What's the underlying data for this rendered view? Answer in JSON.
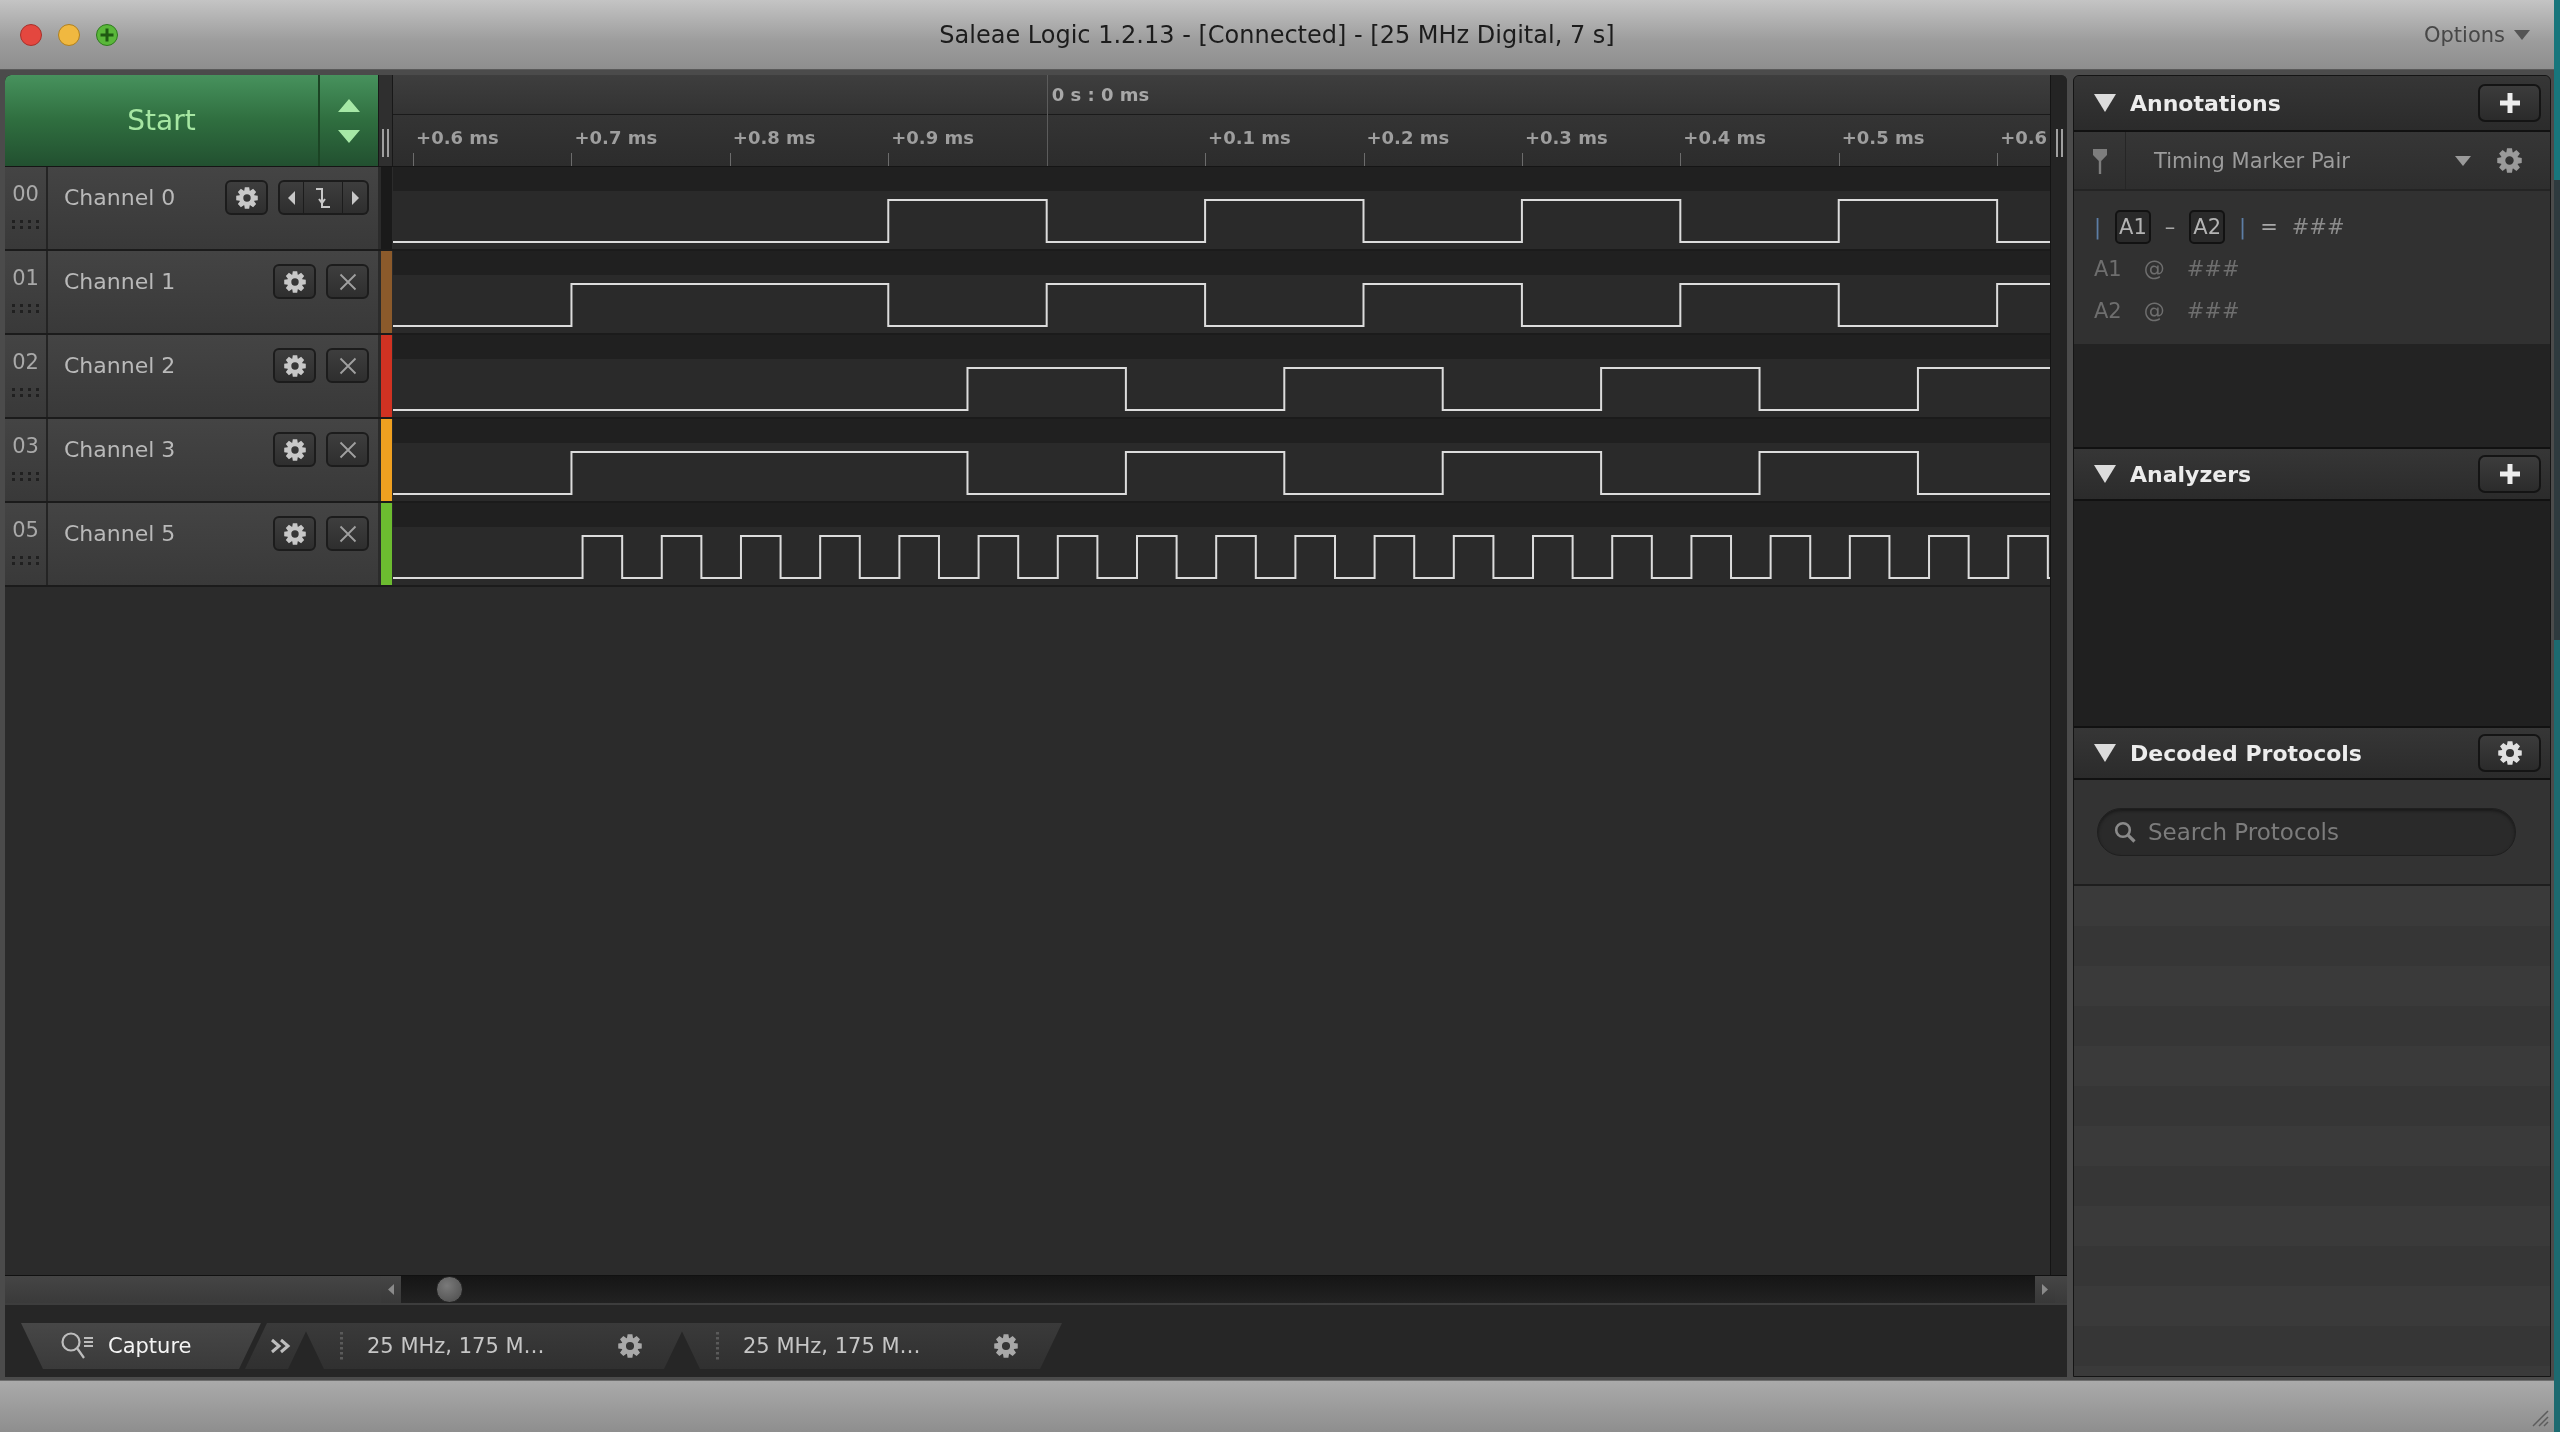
{
  "window": {
    "title": "Saleae Logic 1.2.13 - [Connected] - [25 MHz Digital, 7 s]",
    "options_menu": "Options"
  },
  "capture": {
    "start_button": "Start"
  },
  "ruler": {
    "origin": "0 s : 0 ms",
    "ticks_before": [
      "+0.6 ms",
      "+0.7 ms",
      "+0.8 ms",
      "+0.9 ms"
    ],
    "ticks_after": [
      "+0.1 ms",
      "+0.2 ms",
      "+0.3 ms",
      "+0.4 ms",
      "+0.5 ms",
      "+0.6"
    ]
  },
  "channels": [
    {
      "number": "00",
      "name": "Channel 0",
      "kind": "trigger",
      "color": "#1a1a1a"
    },
    {
      "number": "01",
      "name": "Channel 1",
      "kind": "removable",
      "color": "#8b5a2b"
    },
    {
      "number": "02",
      "name": "Channel 2",
      "kind": "removable",
      "color": "#d03222"
    },
    {
      "number": "03",
      "name": "Channel 3",
      "kind": "removable",
      "color": "#efa020"
    },
    {
      "number": "05",
      "name": "Channel 5",
      "kind": "removable",
      "color": "#6cbc30"
    }
  ],
  "tabs": [
    {
      "kind": "capture",
      "label": "Capture",
      "selected": true
    },
    {
      "kind": "session",
      "label": "25 MHz, 175 M…",
      "selected": false
    },
    {
      "kind": "session",
      "label": "25 MHz, 175 M…",
      "selected": false
    }
  ],
  "annotations": {
    "title": "Annotations",
    "expanded": true,
    "marker_pair": "Timing Marker Pair",
    "measurement": [
      {
        "kind": "bar",
        "text": "|"
      },
      {
        "kind": "marker",
        "text": "A1"
      },
      {
        "kind": "operator",
        "text": "–"
      },
      {
        "kind": "marker",
        "text": "A2"
      },
      {
        "kind": "bar",
        "text": "|"
      },
      {
        "kind": "operator",
        "text": "="
      },
      {
        "kind": "value",
        "text": "###"
      }
    ],
    "markers": [
      {
        "name": "A1",
        "at": "@",
        "value": "###"
      },
      {
        "name": "A2",
        "at": "@",
        "value": "###"
      }
    ]
  },
  "analyzers": {
    "title": "Analyzers",
    "expanded": true
  },
  "decoded_protocols": {
    "title": "Decoded Protocols",
    "expanded": true,
    "search": {
      "placeholder": "Search Protocols"
    }
  }
}
